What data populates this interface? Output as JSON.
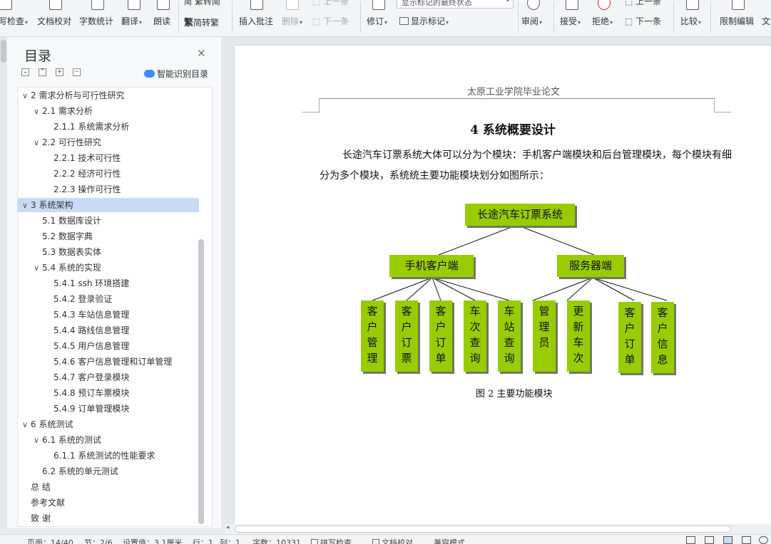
{
  "ribbon": {
    "spellcheck": "写检查",
    "doc_proofread": "文档校对",
    "word_count": "字数统计",
    "translate": "翻译",
    "read_aloud": "朗读",
    "trad_to_simp": "繁转简",
    "simp_to_trad": "简转繁",
    "insert_comment": "插入批注",
    "delete": "删除",
    "previous": "上一条",
    "next": "下一条",
    "track_changes": "修订",
    "markup_dropdown": "显示标记的最终状态",
    "show_markup": "显示标记",
    "review": "审阅",
    "accept": "接受",
    "reject": "拒绝",
    "prev_change": "上一条",
    "next_change": "下一条",
    "compare": "比较",
    "restrict_edit": "限制编辑",
    "doc_permission": "文"
  },
  "sidebar": {
    "title": "目录",
    "smart_toc": "智能识别目录",
    "items": [
      {
        "label": "2  需求分析与可行性研究",
        "toggle": "∨"
      },
      {
        "label": "2.1 需求分析",
        "toggle": "∨"
      },
      {
        "label": "2.1.1 系统需求分析",
        "toggle": ""
      },
      {
        "label": "2.2 可行性研究",
        "toggle": "∨"
      },
      {
        "label": "2.2.1 技术可行性",
        "toggle": ""
      },
      {
        "label": "2.2.2 经济可行性",
        "toggle": ""
      },
      {
        "label": "2.2.3 操作可行性",
        "toggle": ""
      },
      {
        "label": "3 系统架构",
        "toggle": "∨"
      },
      {
        "label": "5.1 数据库设计",
        "toggle": ""
      },
      {
        "label": "5.2 数据字典",
        "toggle": ""
      },
      {
        "label": "5.3  数据表实体",
        "toggle": ""
      },
      {
        "label": "5.4 系统的实现",
        "toggle": "∨"
      },
      {
        "label": "5.4.1 ssh 环境搭建",
        "toggle": ""
      },
      {
        "label": "5.4.2 登录验证",
        "toggle": ""
      },
      {
        "label": "5.4.3 车站信息管理",
        "toggle": ""
      },
      {
        "label": "5.4.4 路线信息管理",
        "toggle": ""
      },
      {
        "label": "5.4.5 用户信息管理",
        "toggle": ""
      },
      {
        "label": "5.4.6 客户信息管理和订单管理",
        "toggle": ""
      },
      {
        "label": "5.4.7 客户登录模块",
        "toggle": ""
      },
      {
        "label": "5.4.8 预订车票模块",
        "toggle": ""
      },
      {
        "label": "5.4.9  订单管理模块",
        "toggle": ""
      },
      {
        "label": "6  系统测试",
        "toggle": "∨"
      },
      {
        "label": "6.1 系统的测试",
        "toggle": "∨"
      },
      {
        "label": "6.1.1 系统测试的性能要求",
        "toggle": ""
      },
      {
        "label": "6.2 系统的单元测试",
        "toggle": ""
      },
      {
        "label": "总  结",
        "toggle": ""
      },
      {
        "label": "参考文献",
        "toggle": ""
      },
      {
        "label": "致  谢",
        "toggle": ""
      }
    ]
  },
  "document": {
    "header": "太原工业学院毕业论文",
    "heading": "4  系统概要设计",
    "paragraph": "长途汽车订票系统大体可以分为个模块：手机客户端模块和后台管理模块，每个模块有细分为多个模块，系统统主要功能模块划分如图所示：",
    "diagram": {
      "root": "长途汽车订票系统",
      "left": "手机客户端",
      "right": "服务器端",
      "left_children": [
        "客户管理",
        "客户订票",
        "客户订单",
        "车次查询",
        "车站查询"
      ],
      "right_children": [
        "管理员",
        "更新车次",
        "客户订单",
        "客户信息"
      ]
    },
    "caption": "图 2  主要功能模块"
  },
  "status": {
    "page": "页面：14/40",
    "section": "节：2/6",
    "setting": "设置值：3.1厘米",
    "row": "行：1",
    "col": "列：1",
    "word_count": "字数：10331",
    "spell_check": "拼写检查",
    "doc_check": "文档校对",
    "compat_mode": "兼容模式"
  }
}
